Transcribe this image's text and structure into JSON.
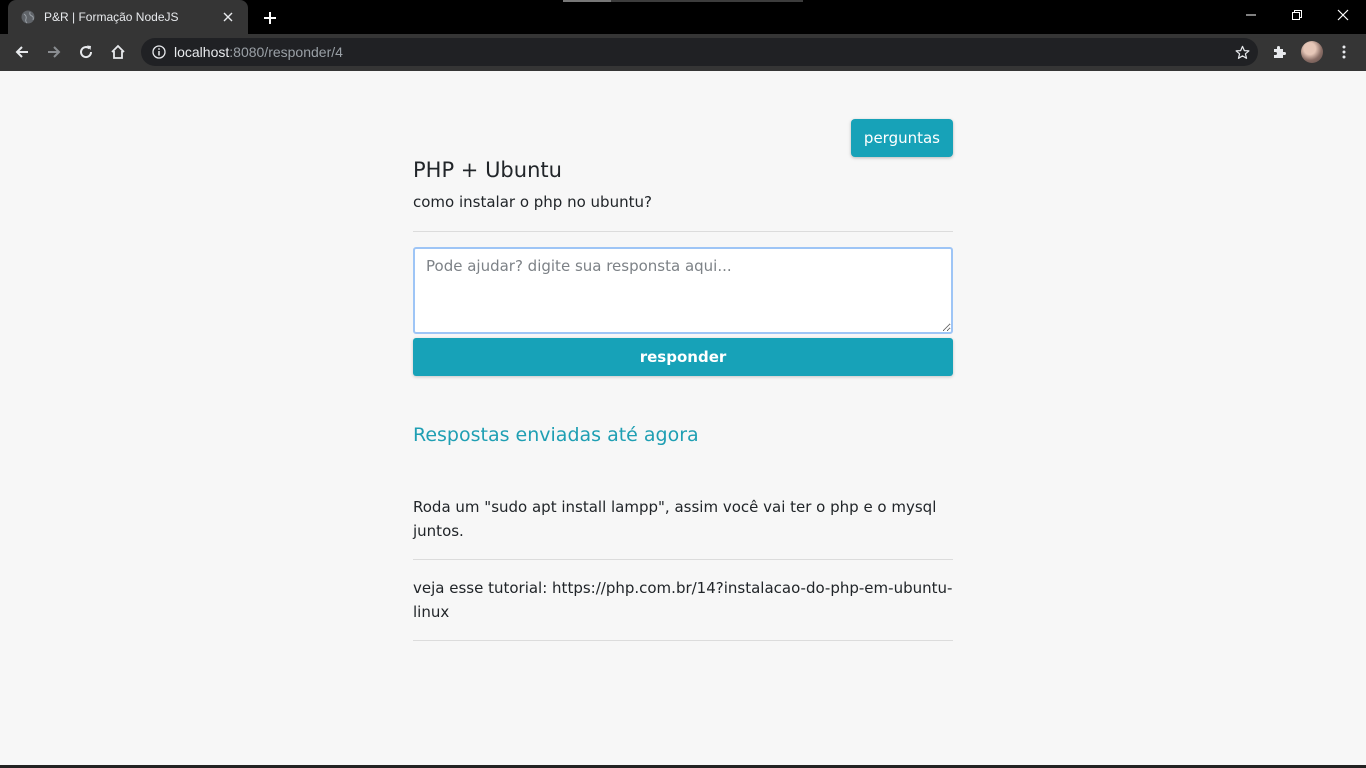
{
  "browser": {
    "tab_title": "P&R | Formação NodeJS",
    "url_host": "localhost",
    "url_rest": ":8080/responder/4",
    "theme": {
      "frame": "#000000",
      "toolbar": "#353535",
      "omnibox": "#202124"
    }
  },
  "page": {
    "nav_button": "perguntas",
    "question": {
      "title": "PHP + Ubuntu",
      "description": "como instalar o php no ubuntu?"
    },
    "form": {
      "placeholder": "Pode ajudar? digite sua responsta aqui...",
      "submit_label": "responder"
    },
    "answers_heading": "Respostas enviadas até agora",
    "answers": [
      {
        "text": "Roda um \"sudo apt install lampp\", assim você vai ter o php e o mysql juntos."
      },
      {
        "text": "veja esse tutorial: https://php.com.br/14?instalacao-do-php-em-ubuntu-linux"
      }
    ],
    "colors": {
      "accent": "#17a2b8",
      "heading_accent": "#1f9fb3",
      "background": "#f7f7f7"
    }
  }
}
